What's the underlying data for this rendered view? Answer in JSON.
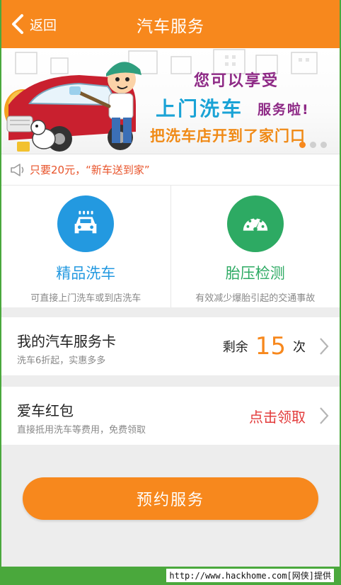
{
  "header": {
    "back_label": "返回",
    "title": "汽车服务"
  },
  "banner": {
    "line1": "您可以享受",
    "line2": "上门洗车",
    "line2_suffix": "服务啦!",
    "line3": "把洗车店开到了家门口",
    "dots_active_index": 0
  },
  "notice": {
    "text": "只要20元，“新车送到家”"
  },
  "services": [
    {
      "name": "精品洗车",
      "desc": "可直接上门洗车或到店洗车",
      "icon": "car-wash-icon",
      "color": "#2399e0"
    },
    {
      "name": "胎压检测",
      "desc": "有效减少爆胎引起的交通事故",
      "icon": "gauge-icon",
      "color": "#2daa63"
    }
  ],
  "service_card": {
    "title": "我的汽车服务卡",
    "subtitle": "洗车6折起，实惠多多",
    "remain_label": "剩余",
    "remain_count": "15",
    "remain_unit": "次"
  },
  "red_packet": {
    "title": "爱车红包",
    "subtitle": "直接抵用洗车等费用，免费领取",
    "action": "点击领取"
  },
  "cta": {
    "label": "预约服务"
  },
  "footer": {
    "text": "http://www.hackhome.com[网侠]提供"
  },
  "colors": {
    "accent": "#f7881d",
    "blue": "#2399e0",
    "green": "#2daa63",
    "red": "#e33b3b"
  }
}
